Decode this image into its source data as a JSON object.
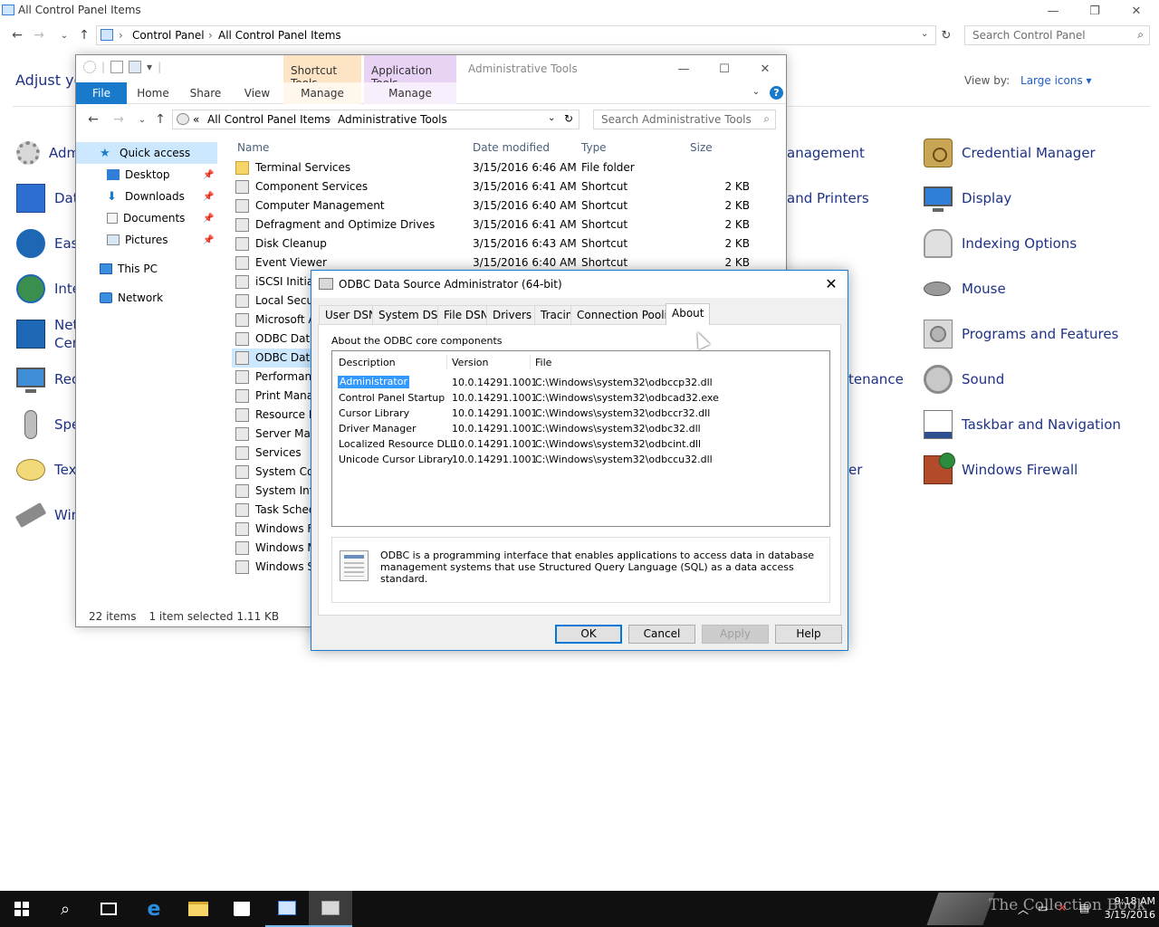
{
  "cp": {
    "title": "All Control Panel Items",
    "breadcrumb": [
      "Control Panel",
      "All Control Panel Items"
    ],
    "search_placeholder": "Search Control Panel",
    "heading": "Adjust yo",
    "view_by_label": "View by:",
    "view_by_value": "Large icons",
    "left_items": [
      "Adm",
      "Dat",
      "Eas",
      "Inte",
      "Net",
      "Cen",
      "Rec",
      "Spe",
      "Tex",
      "Win"
    ],
    "mid_items": [
      "anagement",
      "and Printers",
      "tenance",
      "er"
    ],
    "right_items": [
      {
        "label": "Credential Manager",
        "icon": "credential-manager-icon"
      },
      {
        "label": "Display",
        "icon": "display-icon"
      },
      {
        "label": "Indexing Options",
        "icon": "indexing-options-icon"
      },
      {
        "label": "Mouse",
        "icon": "mouse-icon"
      },
      {
        "label": "Programs and Features",
        "icon": "programs-icon"
      },
      {
        "label": "Sound",
        "icon": "sound-icon"
      },
      {
        "label": "Taskbar and Navigation",
        "icon": "taskbar-icon"
      },
      {
        "label": "Windows Firewall",
        "icon": "firewall-icon"
      }
    ]
  },
  "explorer": {
    "title": "Administrative Tools",
    "ctx_tabs": {
      "shortcut": "Shortcut Tools",
      "app": "Application Tools"
    },
    "ribbon": {
      "file": "File",
      "home": "Home",
      "share": "Share",
      "view": "View",
      "manage1": "Manage",
      "manage2": "Manage"
    },
    "address": {
      "prefix": "«",
      "c1": "All Control Panel Items",
      "c2": "Administrative Tools"
    },
    "search_placeholder": "Search Administrative Tools",
    "nav": {
      "quick_access": "Quick access",
      "desktop": "Desktop",
      "downloads": "Downloads",
      "documents": "Documents",
      "pictures": "Pictures",
      "this_pc": "This PC",
      "network": "Network"
    },
    "columns": {
      "name": "Name",
      "date": "Date modified",
      "type": "Type",
      "size": "Size"
    },
    "files": [
      {
        "name": "Terminal Services",
        "date": "3/15/2016 6:46 AM",
        "type": "File folder",
        "size": ""
      },
      {
        "name": "Component Services",
        "date": "3/15/2016 6:41 AM",
        "type": "Shortcut",
        "size": "2 KB"
      },
      {
        "name": "Computer Management",
        "date": "3/15/2016 6:40 AM",
        "type": "Shortcut",
        "size": "2 KB"
      },
      {
        "name": "Defragment and Optimize Drives",
        "date": "3/15/2016 6:41 AM",
        "type": "Shortcut",
        "size": "2 KB"
      },
      {
        "name": "Disk Cleanup",
        "date": "3/15/2016 6:43 AM",
        "type": "Shortcut",
        "size": "2 KB"
      },
      {
        "name": "Event Viewer",
        "date": "3/15/2016 6:40 AM",
        "type": "Shortcut",
        "size": "2 KB"
      },
      {
        "name": "iSCSI Initiato",
        "date": "",
        "type": "",
        "size": ""
      },
      {
        "name": "Local Secur",
        "date": "",
        "type": "",
        "size": ""
      },
      {
        "name": "Microsoft A",
        "date": "",
        "type": "",
        "size": ""
      },
      {
        "name": "ODBC Data",
        "date": "",
        "type": "",
        "size": ""
      },
      {
        "name": "ODBC Data",
        "date": "",
        "type": "",
        "size": ""
      },
      {
        "name": "Performanc",
        "date": "",
        "type": "",
        "size": ""
      },
      {
        "name": "Print Manag",
        "date": "",
        "type": "",
        "size": ""
      },
      {
        "name": "Resource M",
        "date": "",
        "type": "",
        "size": ""
      },
      {
        "name": "Server Mana",
        "date": "",
        "type": "",
        "size": ""
      },
      {
        "name": "Services",
        "date": "",
        "type": "",
        "size": ""
      },
      {
        "name": "System Cor",
        "date": "",
        "type": "",
        "size": ""
      },
      {
        "name": "System Info",
        "date": "",
        "type": "",
        "size": ""
      },
      {
        "name": "Task Schedu",
        "date": "",
        "type": "",
        "size": ""
      },
      {
        "name": "Windows Fi",
        "date": "",
        "type": "",
        "size": ""
      },
      {
        "name": "Windows M",
        "date": "",
        "type": "",
        "size": ""
      },
      {
        "name": "Windows Se",
        "date": "",
        "type": "",
        "size": ""
      }
    ],
    "status": {
      "count": "22 items",
      "selected": "1 item selected",
      "size": "1.11 KB"
    }
  },
  "dialog": {
    "title": "ODBC Data Source Administrator (64-bit)",
    "tabs": [
      "User DSN",
      "System DSN",
      "File DSN",
      "Drivers",
      "Tracing",
      "Connection Pooling",
      "About"
    ],
    "active_tab": "About",
    "about_label": "About the ODBC core components",
    "columns": {
      "desc": "Description",
      "ver": "Version",
      "file": "File"
    },
    "components": [
      {
        "desc": "Administrator",
        "ver": "10.0.14291.1001",
        "file": "C:\\Windows\\system32\\odbccp32.dll"
      },
      {
        "desc": "Control Panel Startup",
        "ver": "10.0.14291.1001",
        "file": "C:\\Windows\\system32\\odbcad32.exe"
      },
      {
        "desc": "Cursor Library",
        "ver": "10.0.14291.1001",
        "file": "C:\\Windows\\system32\\odbccr32.dll"
      },
      {
        "desc": "Driver Manager",
        "ver": "10.0.14291.1001",
        "file": "C:\\Windows\\system32\\odbc32.dll"
      },
      {
        "desc": "Localized Resource DLL",
        "ver": "10.0.14291.1001",
        "file": "C:\\Windows\\system32\\odbcint.dll"
      },
      {
        "desc": "Unicode Cursor Library",
        "ver": "10.0.14291.1001",
        "file": "C:\\Windows\\system32\\odbccu32.dll"
      }
    ],
    "info": "ODBC is a programming interface that enables applications to access data in database management systems that use Structured Query Language (SQL) as a data access standard.",
    "buttons": {
      "ok": "OK",
      "cancel": "Cancel",
      "apply": "Apply",
      "help": "Help"
    }
  },
  "taskbar": {
    "brand": "The Collection Book",
    "time": "9:18 AM",
    "date": "3/15/2016"
  },
  "colors": {
    "accent": "#1979ca",
    "link": "#1e3287",
    "selection": "#cce8ff"
  }
}
